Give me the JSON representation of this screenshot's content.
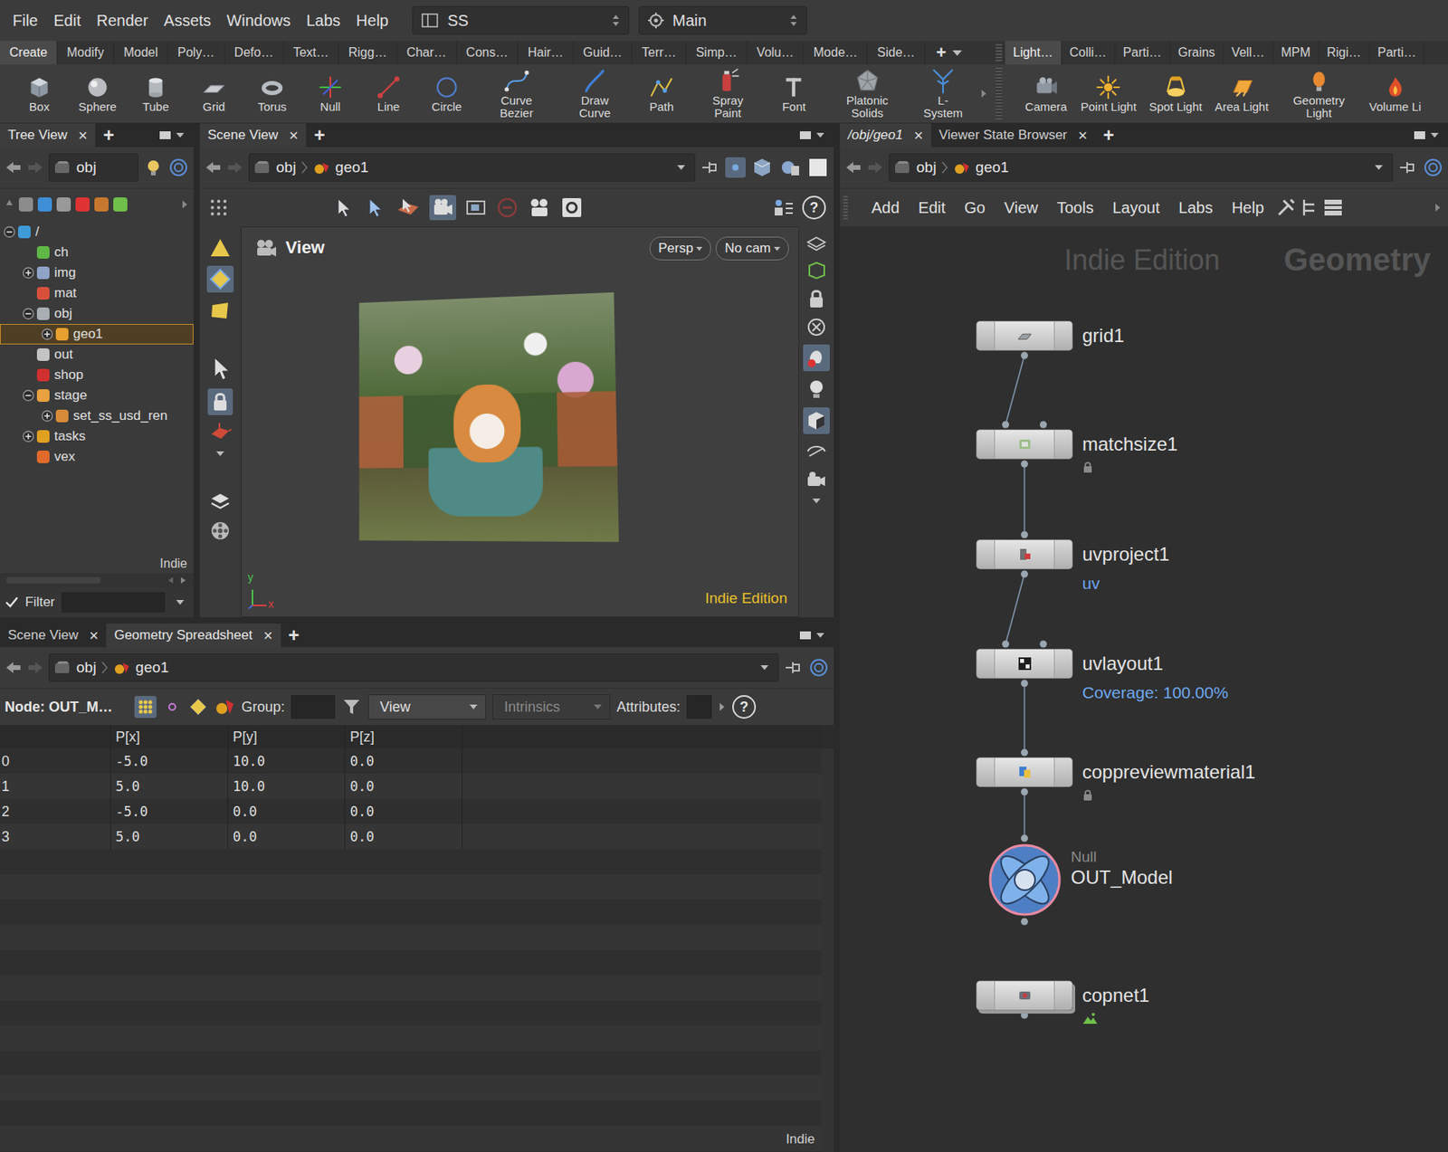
{
  "menu_bar": {
    "items": [
      "File",
      "Edit",
      "Render",
      "Assets",
      "Windows",
      "Labs",
      "Help"
    ],
    "desktop": "SS",
    "run_mode": "Main"
  },
  "shelf": {
    "left_tabs": [
      {
        "label": "Create",
        "selected": true
      },
      {
        "label": "Modify",
        "selected": false
      },
      {
        "label": "Model",
        "selected": false
      },
      {
        "label": "Poly…",
        "selected": false
      },
      {
        "label": "Defo…",
        "selected": false
      },
      {
        "label": "Text…",
        "selected": false
      },
      {
        "label": "Rigg…",
        "selected": false
      },
      {
        "label": "Char…",
        "selected": false
      },
      {
        "label": "Cons…",
        "selected": false
      },
      {
        "label": "Hair…",
        "selected": false
      },
      {
        "label": "Guid…",
        "selected": false
      },
      {
        "label": "Terr…",
        "selected": false
      },
      {
        "label": "Simp…",
        "selected": false
      },
      {
        "label": "Volu…",
        "selected": false
      },
      {
        "label": "Mode…",
        "selected": false
      },
      {
        "label": "Side…",
        "selected": false
      }
    ],
    "add": "+",
    "right_tabs": [
      {
        "label": "Light…",
        "selected": true
      },
      {
        "label": "Colli…",
        "selected": false
      },
      {
        "label": "Parti…",
        "selected": false
      },
      {
        "label": "Grains",
        "selected": false
      },
      {
        "label": "Vell…",
        "selected": false
      },
      {
        "label": "MPM",
        "selected": false
      },
      {
        "label": "Rigi…",
        "selected": false
      },
      {
        "label": "Parti…",
        "selected": false
      }
    ],
    "left_tools": [
      "Box",
      "Sphere",
      "Tube",
      "Grid",
      "Torus",
      "Null",
      "Line",
      "Circle",
      "Curve Bezier",
      "Draw Curve",
      "Path",
      "Spray Paint",
      "Font",
      "Platonic Solids",
      "L-System"
    ],
    "right_tools": [
      "Camera",
      "Point Light",
      "Spot Light",
      "Area Light",
      "Geometry Light",
      "Volume Li"
    ]
  },
  "tree_view": {
    "tab": "Tree View",
    "close": "×",
    "add": "+",
    "path": "obj",
    "items": [
      {
        "label": "/",
        "depth": 0,
        "has_children": true,
        "expanded": true,
        "selected": false,
        "color": "#3f9ad8"
      },
      {
        "label": "ch",
        "depth": 1,
        "has_children": false,
        "expanded": false,
        "selected": false,
        "color": "#5fb845"
      },
      {
        "label": "img",
        "depth": 1,
        "has_children": true,
        "expanded": false,
        "selected": false,
        "color": "#8fa2c8"
      },
      {
        "label": "mat",
        "depth": 1,
        "has_children": false,
        "expanded": false,
        "selected": false,
        "color": "#d8503a"
      },
      {
        "label": "obj",
        "depth": 1,
        "has_children": true,
        "expanded": true,
        "selected": false,
        "color": "#a8aeb4"
      },
      {
        "label": "geo1",
        "depth": 2,
        "has_children": true,
        "expanded": false,
        "selected": true,
        "color": "#e8a030"
      },
      {
        "label": "out",
        "depth": 1,
        "has_children": false,
        "expanded": false,
        "selected": false,
        "color": "#c4c4c4"
      },
      {
        "label": "shop",
        "depth": 1,
        "has_children": false,
        "expanded": false,
        "selected": false,
        "color": "#d03030"
      },
      {
        "label": "stage",
        "depth": 1,
        "has_children": true,
        "expanded": true,
        "selected": false,
        "color": "#e8a040"
      },
      {
        "label": "set_ss_usd_ren",
        "depth": 2,
        "has_children": true,
        "expanded": false,
        "selected": false,
        "color": "#d88c3a"
      },
      {
        "label": "tasks",
        "depth": 1,
        "has_children": true,
        "expanded": false,
        "selected": false,
        "color": "#e0a020"
      },
      {
        "label": "vex",
        "depth": 1,
        "has_children": false,
        "expanded": false,
        "selected": false,
        "color": "#e06a2a"
      }
    ],
    "footer": "Indie",
    "filter": {
      "label": "Filter",
      "checked": true
    }
  },
  "scene_view": {
    "tab": "Scene View",
    "close": "×",
    "add": "+",
    "path": [
      "obj",
      "geo1"
    ],
    "help": "?",
    "viewport": {
      "title": "View",
      "projection": "Persp",
      "camera": "No cam",
      "watermark": "Indie Edition",
      "axes": {
        "y": "y",
        "x": "x"
      }
    }
  },
  "spreadsheet": {
    "tabs": [
      {
        "label": "Scene View",
        "selected": false
      },
      {
        "label": "Geometry Spreadsheet",
        "selected": true
      }
    ],
    "close": "×",
    "add": "+",
    "path": [
      "obj",
      "geo1"
    ],
    "node": "Node: OUT_M…",
    "group_label": "Group:",
    "view": "View",
    "intrinsics": "Intrinsics",
    "attributes_label": "Attributes:",
    "help": "?",
    "columns": [
      "P[x]",
      "P[y]",
      "P[z]"
    ],
    "rows": [
      {
        "index": "0",
        "values": [
          "-5.0",
          "10.0",
          "0.0"
        ]
      },
      {
        "index": "1",
        "values": [
          "5.0",
          "10.0",
          "0.0"
        ]
      },
      {
        "index": "2",
        "values": [
          "-5.0",
          "0.0",
          "0.0"
        ]
      },
      {
        "index": "3",
        "values": [
          "5.0",
          "0.0",
          "0.0"
        ]
      }
    ],
    "footer": "Indie"
  },
  "network": {
    "tabs": [
      {
        "label": "/obj/geo1",
        "selected": true
      },
      {
        "label": "Viewer State Browser",
        "selected": false
      }
    ],
    "close": "×",
    "add": "+",
    "path": [
      "obj",
      "geo1"
    ],
    "menu": [
      "Add",
      "Edit",
      "Go",
      "View",
      "Tools",
      "Layout",
      "Labs",
      "Help"
    ],
    "watermark": "Indie Edition",
    "context": "Geometry",
    "nodes": [
      {
        "name": "grid1",
        "kind": "sop",
        "inputs": 0,
        "from": null,
        "type_label": "",
        "comment": "",
        "locked": false,
        "display": false
      },
      {
        "name": "matchsize1",
        "kind": "sop",
        "inputs": 2,
        "from": 0,
        "type_label": "",
        "comment": "",
        "locked": true,
        "display": false
      },
      {
        "name": "uvproject1",
        "kind": "sop",
        "inputs": 1,
        "from": 1,
        "type_label": "",
        "comment": "uv",
        "locked": false,
        "display": false
      },
      {
        "name": "uvlayout1",
        "kind": "sop",
        "inputs": 2,
        "from": 2,
        "type_label": "",
        "comment": "Coverage: 100.00%",
        "locked": false,
        "display": false
      },
      {
        "name": "coppreviewmaterial1",
        "kind": "sop",
        "inputs": 1,
        "from": 3,
        "type_label": "",
        "comment": "",
        "locked": true,
        "display": false
      },
      {
        "name": "OUT_Model",
        "kind": "null",
        "inputs": 1,
        "from": 4,
        "type_label": "Null",
        "comment": "",
        "locked": false,
        "display": true
      },
      {
        "name": "copnet1",
        "kind": "subnet",
        "inputs": 0,
        "from": null,
        "type_label": "",
        "comment": "",
        "locked": false,
        "display": false
      }
    ]
  }
}
